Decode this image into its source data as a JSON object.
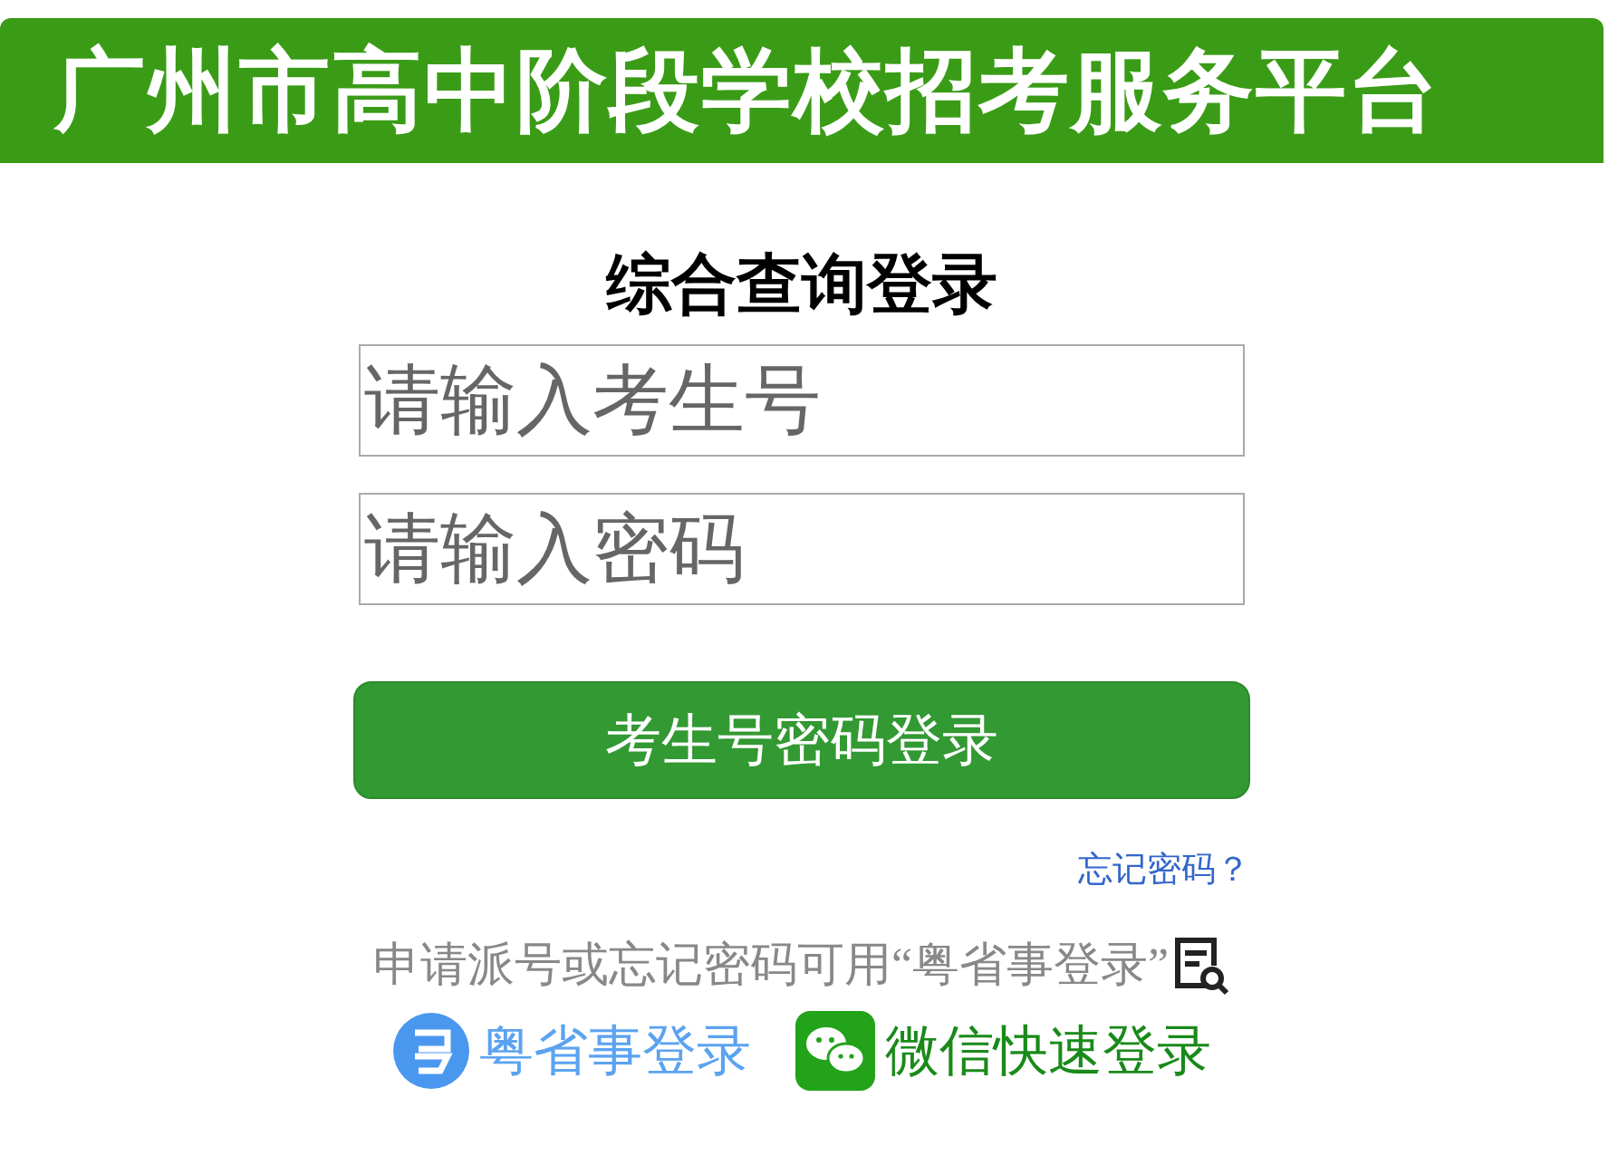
{
  "header": {
    "title": "广州市高中阶段学校招考服务平台"
  },
  "login": {
    "heading": "综合查询登录",
    "fields": [
      {
        "placeholder": "请输入考生号"
      },
      {
        "placeholder": "请输入密码"
      }
    ],
    "submit": "考生号密码登录",
    "forgot": "忘记密码？",
    "note": "申请派号或忘记密码可用“粤省事登录”",
    "alt_logins": [
      {
        "kind": "yueshengshi",
        "label": "粤省事登录"
      },
      {
        "kind": "wechat",
        "label": "微信快速登录"
      }
    ]
  }
}
